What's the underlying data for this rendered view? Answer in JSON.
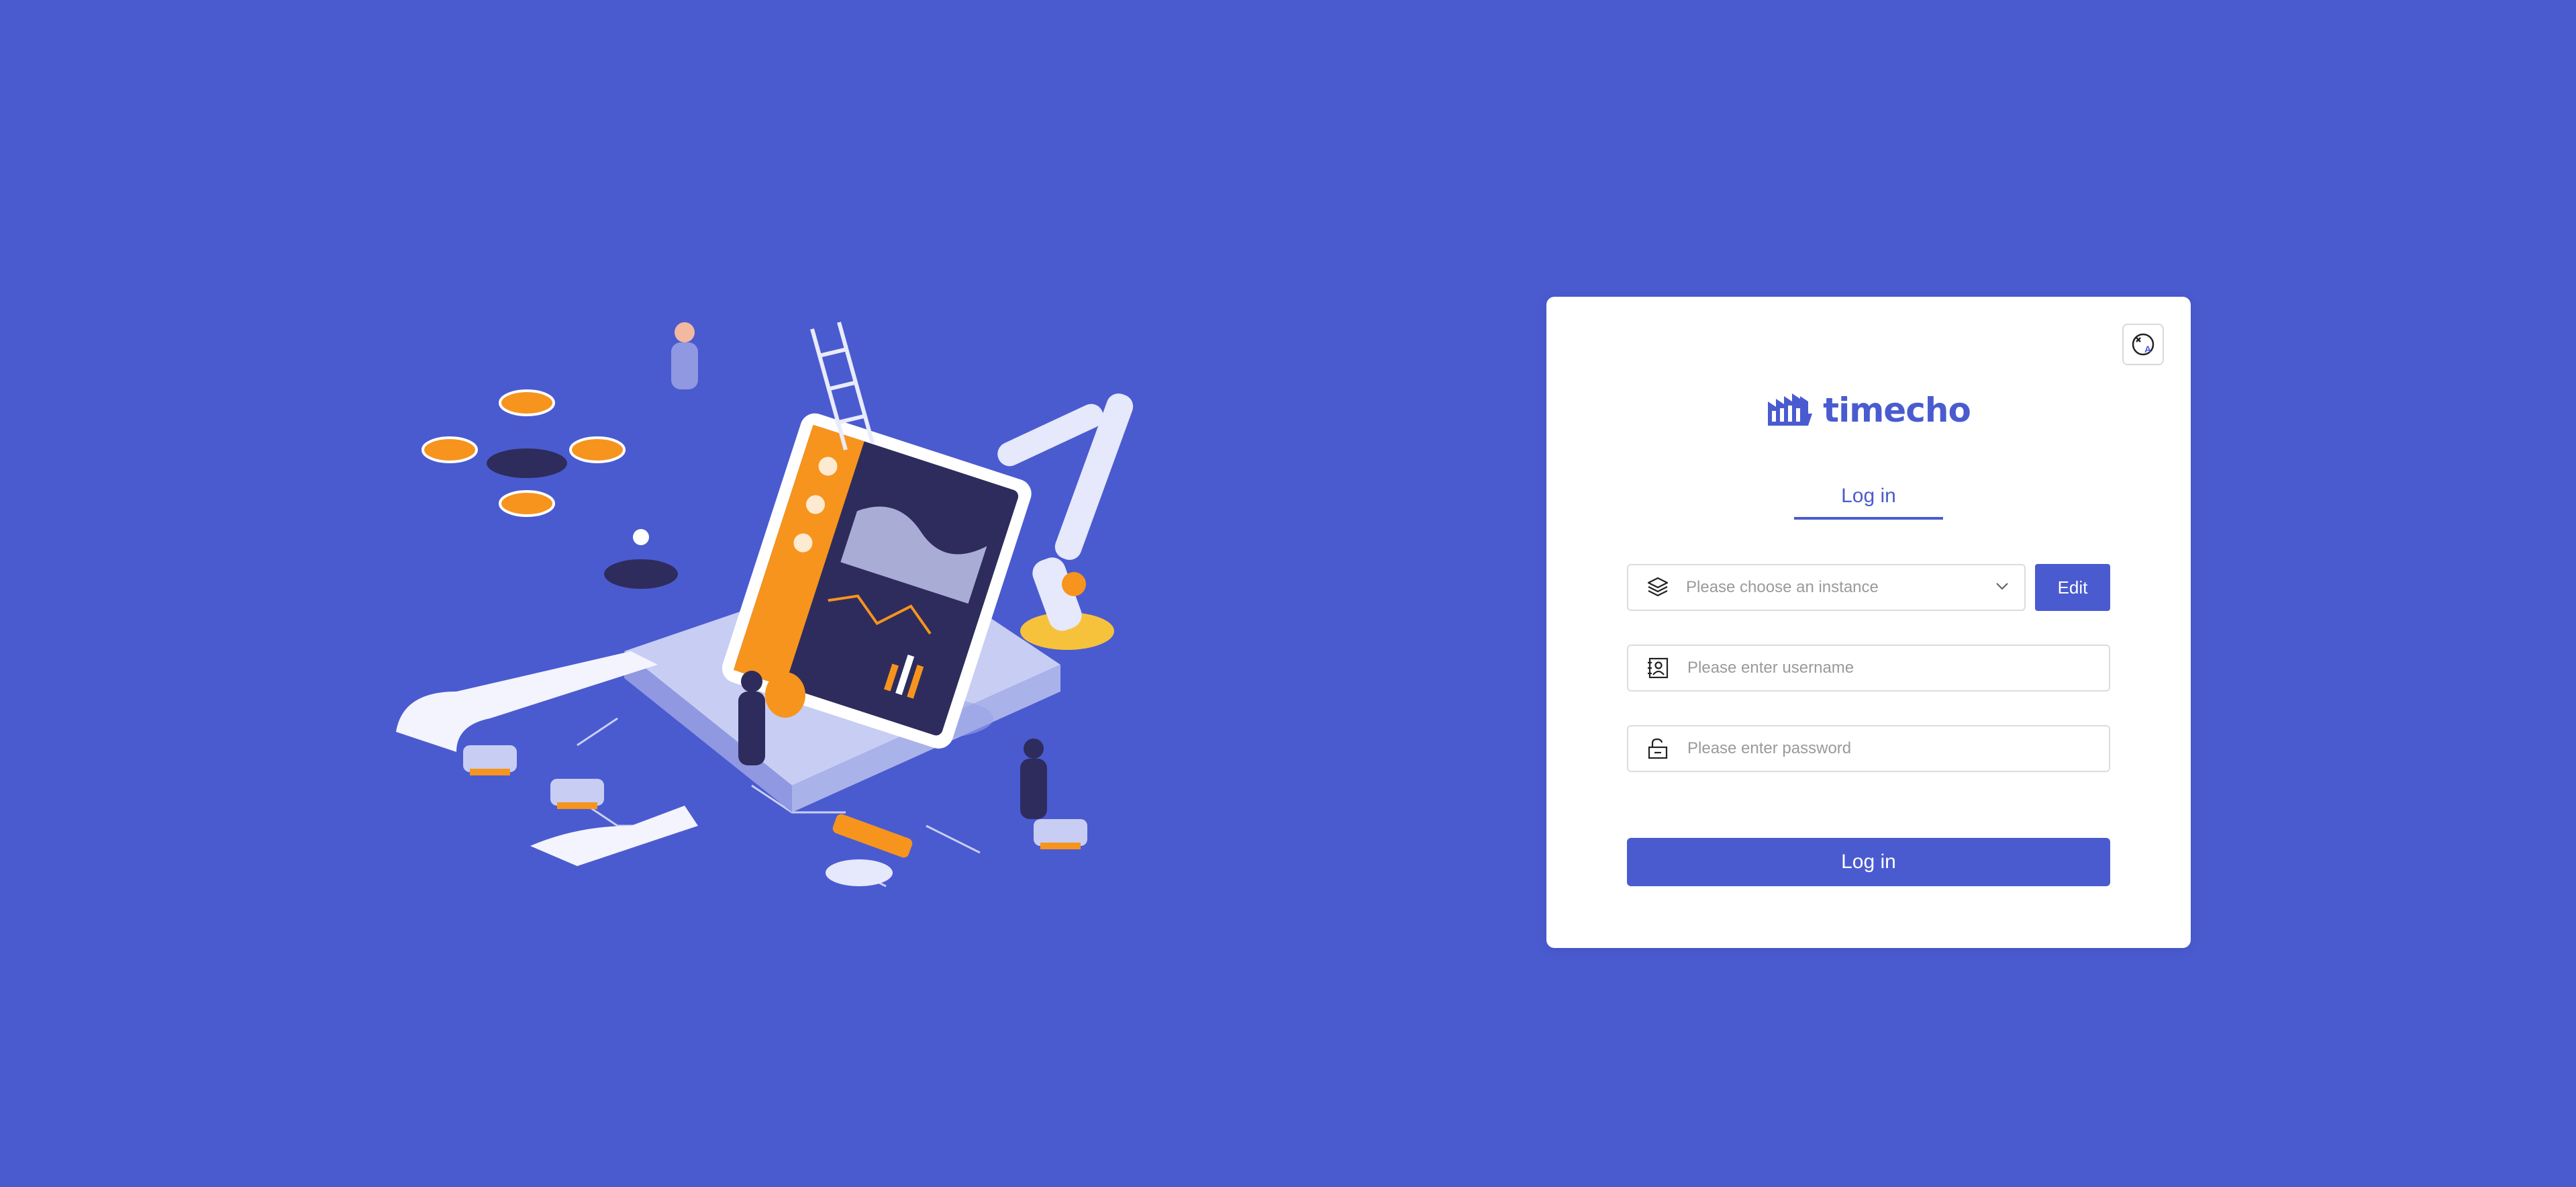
{
  "brand": {
    "name": "timecho",
    "color": "#4a5bd0",
    "background": "#4a5bd0",
    "accent_orange": "#f7941d"
  },
  "lang_switch": {
    "icon": "translate-icon"
  },
  "tabs": [
    {
      "label": "Log in",
      "active": true
    }
  ],
  "form": {
    "instance_placeholder": "Please choose an instance",
    "instance_icon": "layers-icon",
    "edit_label": "Edit",
    "username_placeholder": "Please enter username",
    "username_icon": "user-card-icon",
    "password_placeholder": "Please enter password",
    "password_icon": "unlock-icon",
    "submit_label": "Log in"
  }
}
